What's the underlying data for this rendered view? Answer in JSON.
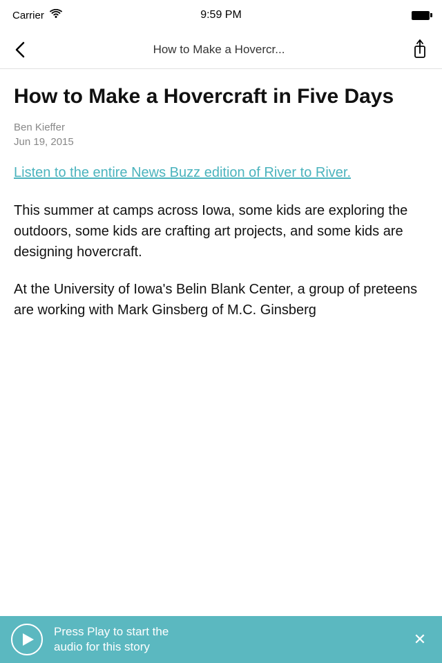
{
  "status_bar": {
    "carrier": "Carrier",
    "time": "9:59 PM"
  },
  "nav": {
    "title": "How to Make a Hovercr...",
    "back_label": "‹",
    "share_label": "Share"
  },
  "article": {
    "title": "How to Make a Hovercraft in Five Days",
    "author": "Ben Kieffer",
    "date": "Jun 19, 2015",
    "link_text": "Listen to the entire News Buzz edition of River to River.",
    "body_paragraph_1": "This summer at camps across Iowa, some kids are exploring the outdoors, some kids are crafting art projects, and some kids are designing hovercraft.",
    "body_paragraph_2": "At the University of Iowa's Belin Blank Center, a group of preteens are working with Mark Ginsberg of M.C. Ginsberg"
  },
  "audio_player": {
    "message_line1": "Press Play to start the",
    "message_line2": "audio for this story",
    "background_color": "#5bb8c0"
  }
}
